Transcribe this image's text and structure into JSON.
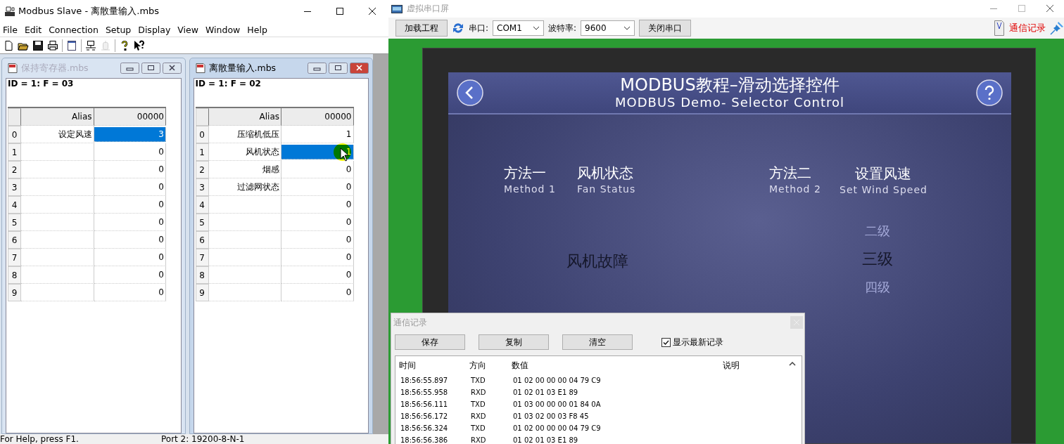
{
  "modbus_slave": {
    "title": "Modbus Slave - 离散量输入.mbs",
    "menu": [
      "File",
      "Edit",
      "Connection",
      "Setup",
      "Display",
      "View",
      "Window",
      "Help"
    ],
    "toolbar": [
      {
        "kind": "new",
        "disabled": false
      },
      {
        "kind": "open",
        "disabled": false
      },
      {
        "kind": "save",
        "disabled": false
      },
      {
        "kind": "print",
        "disabled": false
      },
      {
        "kind": "sep"
      },
      {
        "kind": "window",
        "disabled": false
      },
      {
        "kind": "sep"
      },
      {
        "kind": "connect",
        "disabled": false
      },
      {
        "kind": "disconnect",
        "disabled": true
      },
      {
        "kind": "sep"
      },
      {
        "kind": "help",
        "disabled": false
      },
      {
        "kind": "context-help",
        "disabled": false
      }
    ],
    "windows": [
      {
        "title": "保持寄存器.mbs",
        "active": false,
        "id_line": "ID = 1: F = 03",
        "columns": [
          "Alias",
          "00000"
        ],
        "rows": [
          {
            "index": "0",
            "alias": "设定风速",
            "value": "3",
            "selected": true
          },
          {
            "index": "1",
            "alias": "",
            "value": "0",
            "selected": false
          },
          {
            "index": "2",
            "alias": "",
            "value": "0",
            "selected": false
          },
          {
            "index": "3",
            "alias": "",
            "value": "0",
            "selected": false
          },
          {
            "index": "4",
            "alias": "",
            "value": "0",
            "selected": false
          },
          {
            "index": "5",
            "alias": "",
            "value": "0",
            "selected": false
          },
          {
            "index": "6",
            "alias": "",
            "value": "0",
            "selected": false
          },
          {
            "index": "7",
            "alias": "",
            "value": "0",
            "selected": false
          },
          {
            "index": "8",
            "alias": "",
            "value": "0",
            "selected": false
          },
          {
            "index": "9",
            "alias": "",
            "value": "0",
            "selected": false
          }
        ]
      },
      {
        "title": "离散量输入.mbs",
        "active": true,
        "id_line": "ID = 1: F = 02",
        "columns": [
          "Alias",
          "00000"
        ],
        "rows": [
          {
            "index": "0",
            "alias": "压缩机低压",
            "value": "1",
            "selected": false
          },
          {
            "index": "1",
            "alias": "风机状态",
            "value": "1",
            "selected": true
          },
          {
            "index": "2",
            "alias": "烟感",
            "value": "0",
            "selected": false
          },
          {
            "index": "3",
            "alias": "过滤网状态",
            "value": "0",
            "selected": false
          },
          {
            "index": "4",
            "alias": "",
            "value": "0",
            "selected": false
          },
          {
            "index": "5",
            "alias": "",
            "value": "0",
            "selected": false
          },
          {
            "index": "6",
            "alias": "",
            "value": "0",
            "selected": false
          },
          {
            "index": "7",
            "alias": "",
            "value": "0",
            "selected": false
          },
          {
            "index": "8",
            "alias": "",
            "value": "0",
            "selected": false
          },
          {
            "index": "9",
            "alias": "",
            "value": "0",
            "selected": false
          }
        ]
      }
    ],
    "status_bar": [
      "For Help, press F1.",
      "Port 2: 19200-8-N-1"
    ]
  },
  "serial_screen": {
    "title": "虚拟串口屏",
    "toolbar": {
      "load_button": "加载工程",
      "port_label": "串口:",
      "port_value": "COM1",
      "baud_label": "波特率:",
      "baud_value": "9600",
      "close_port_button": "关闭串口",
      "log_link": "通信记录"
    },
    "hmi": {
      "title": "MODBUS教程–滑动选择控件",
      "subtitle": "MODBUS Demo- Selector Control",
      "method_1": {
        "label": "方法一",
        "label_en": "Method 1"
      },
      "fan_status": {
        "label": "风机状态",
        "label_en": "Fan Status",
        "value": "风机故障"
      },
      "method_2": {
        "label": "方法二",
        "label_en": "Method 2"
      },
      "wind_speed": {
        "label": "设置风速",
        "label_en": "Set Wind Speed"
      },
      "selector": [
        {
          "label": "二级",
          "selected": false
        },
        {
          "label": "三级",
          "selected": true
        },
        {
          "label": "四级",
          "selected": false
        }
      ]
    }
  },
  "comm_log": {
    "title": "通信记录",
    "buttons": [
      "保存",
      "复制",
      "清空"
    ],
    "show_latest": {
      "label": "显示最新记录",
      "checked": true
    },
    "columns": [
      "时间",
      "方向",
      "数值",
      "说明"
    ],
    "rows": [
      {
        "time": "18:56:55.897",
        "direction": "TXD",
        "value": "01 02 00 00 00 04 79 C9"
      },
      {
        "time": "18:56:55.958",
        "direction": "RXD",
        "value": "01 02 01 03 E1 89"
      },
      {
        "time": "18:56:56.111",
        "direction": "TXD",
        "value": "01 03 00 00 00 01 84 0A"
      },
      {
        "time": "18:56:56.172",
        "direction": "RXD",
        "value": "01 03 02 00 03 F8 45"
      },
      {
        "time": "18:56:56.324",
        "direction": "TXD",
        "value": "01 02 00 00 00 04 79 C9"
      },
      {
        "time": "18:56:56.386",
        "direction": "RXD",
        "value": "01 02 01 03 E1 89"
      }
    ]
  }
}
